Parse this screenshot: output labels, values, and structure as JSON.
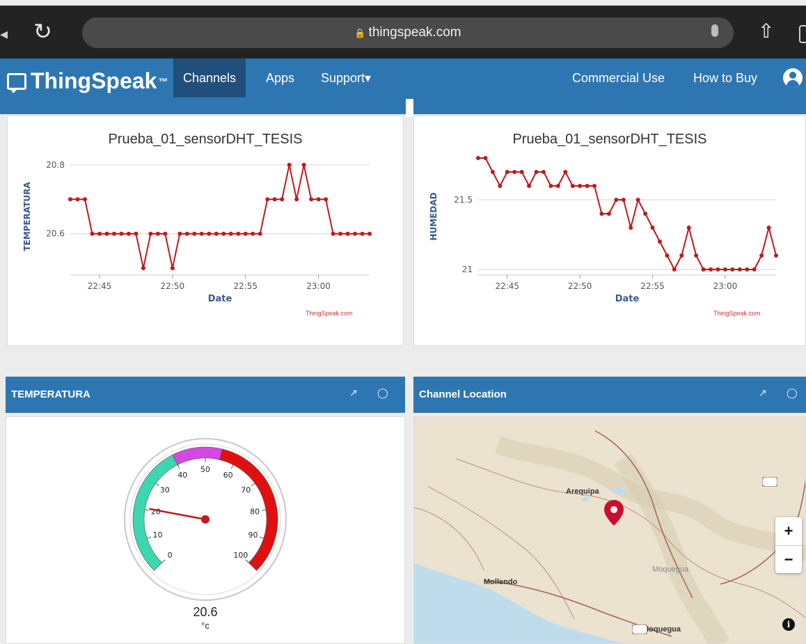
{
  "browser": {
    "url": "thingspeak.com",
    "reload_icon": "reload-icon",
    "share_icon": "share-icon"
  },
  "nav": {
    "logo": "ThingSpeak",
    "trademark": "™",
    "items": [
      "Channels",
      "Apps",
      "Support",
      "Commercial Use",
      "How to Buy"
    ],
    "dropdown_caret": "▾"
  },
  "colors": {
    "nav_blue": "#2e76b1",
    "active_nav": "#1f4f7a",
    "series_red": "#c0191e"
  },
  "credit_text": "ThingSpeak.com",
  "chart_data": [
    {
      "type": "line",
      "title": "Prueba_01_sensorDHT_TESIS",
      "xlabel": "Date",
      "ylabel": "TEMPERATURA",
      "ylim": [
        20.48,
        20.82
      ],
      "y_ticks": [
        20.6,
        20.8
      ],
      "xlim": [
        "22:43",
        "23:03:30"
      ],
      "x_ticks": [
        "22:45",
        "22:50",
        "22:55",
        "23:00"
      ],
      "grid": true,
      "series": [
        {
          "x": [
            "22:43:00",
            "22:43:30",
            "22:44:00",
            "22:44:30",
            "22:45:00",
            "22:45:30",
            "22:46:00",
            "22:46:30",
            "22:47:00",
            "22:47:30",
            "22:48:00",
            "22:48:30",
            "22:49:00",
            "22:49:30",
            "22:50:00",
            "22:50:30",
            "22:51:00",
            "22:51:30",
            "22:52:00",
            "22:52:30",
            "22:53:00",
            "22:53:30",
            "22:54:00",
            "22:54:30",
            "22:55:00",
            "22:55:30",
            "22:56:00",
            "22:56:30",
            "22:57:00",
            "22:57:30",
            "22:58:00",
            "22:58:30",
            "22:59:00",
            "22:59:30",
            "23:00:00",
            "23:00:30",
            "23:01:00",
            "23:01:30",
            "23:02:00",
            "23:02:30",
            "23:03:00",
            "23:03:30"
          ],
          "values": [
            20.7,
            20.7,
            20.7,
            20.6,
            20.6,
            20.6,
            20.6,
            20.6,
            20.6,
            20.6,
            20.5,
            20.6,
            20.6,
            20.6,
            20.5,
            20.6,
            20.6,
            20.6,
            20.6,
            20.6,
            20.6,
            20.6,
            20.6,
            20.6,
            20.6,
            20.6,
            20.6,
            20.7,
            20.7,
            20.7,
            20.8,
            20.7,
            20.8,
            20.7,
            20.7,
            20.7,
            20.6,
            20.6,
            20.6,
            20.6,
            20.6,
            20.6
          ]
        }
      ]
    },
    {
      "type": "line",
      "title": "Prueba_01_sensorDHT_TESIS",
      "xlabel": "Date",
      "ylabel": "HUMEDAD",
      "ylim": [
        20.96,
        21.8
      ],
      "y_ticks": [
        21,
        21.5
      ],
      "xlim": [
        "22:43",
        "23:03:30"
      ],
      "x_ticks": [
        "22:45",
        "22:50",
        "22:55",
        "23:00"
      ],
      "grid": true,
      "series": [
        {
          "x": [
            "22:43:00",
            "22:43:30",
            "22:44:00",
            "22:44:30",
            "22:45:00",
            "22:45:30",
            "22:46:00",
            "22:46:30",
            "22:47:00",
            "22:47:30",
            "22:48:00",
            "22:48:30",
            "22:49:00",
            "22:49:30",
            "22:50:00",
            "22:50:30",
            "22:51:00",
            "22:51:30",
            "22:52:00",
            "22:52:30",
            "22:53:00",
            "22:53:30",
            "22:54:00",
            "22:54:30",
            "22:55:00",
            "22:55:30",
            "22:56:00",
            "22:56:30",
            "22:57:00",
            "22:57:30",
            "22:58:00",
            "22:58:30",
            "22:59:00",
            "22:59:30",
            "23:00:00",
            "23:00:30",
            "23:01:00",
            "23:01:30",
            "23:02:00",
            "23:02:30",
            "23:03:00",
            "23:03:30"
          ],
          "values": [
            21.8,
            21.8,
            21.7,
            21.6,
            21.7,
            21.7,
            21.7,
            21.6,
            21.7,
            21.7,
            21.6,
            21.6,
            21.7,
            21.6,
            21.6,
            21.6,
            21.6,
            21.4,
            21.4,
            21.5,
            21.5,
            21.3,
            21.5,
            21.4,
            21.3,
            21.2,
            21.1,
            21.0,
            21.1,
            21.3,
            21.1,
            21.0,
            21.0,
            21.0,
            21.0,
            21.0,
            21.0,
            21.0,
            21.0,
            21.1,
            21.3,
            21.1
          ]
        }
      ]
    }
  ],
  "panels": {
    "gauge": {
      "title": "TEMPERATURA",
      "value": "20.6",
      "unit": "°c",
      "reading": 20.6,
      "min": 0,
      "max": 100,
      "tick_labels": [
        "0",
        "10",
        "20",
        "30",
        "40",
        "50",
        "60",
        "70",
        "80",
        "90",
        "100"
      ],
      "bands": [
        {
          "from": 0,
          "to": 40,
          "color": "#3dd6b0"
        },
        {
          "from": 40,
          "to": 55,
          "color": "#d24adf"
        },
        {
          "from": 55,
          "to": 100,
          "color": "#e01010"
        }
      ]
    },
    "map": {
      "title": "Channel Location",
      "labels": [
        "Arequipa",
        "Mollendo",
        "Moquegua",
        "Moquegua"
      ],
      "zoom_in": "+",
      "zoom_out": "−",
      "info": "i",
      "pin_icon": "map-pin-icon"
    }
  }
}
